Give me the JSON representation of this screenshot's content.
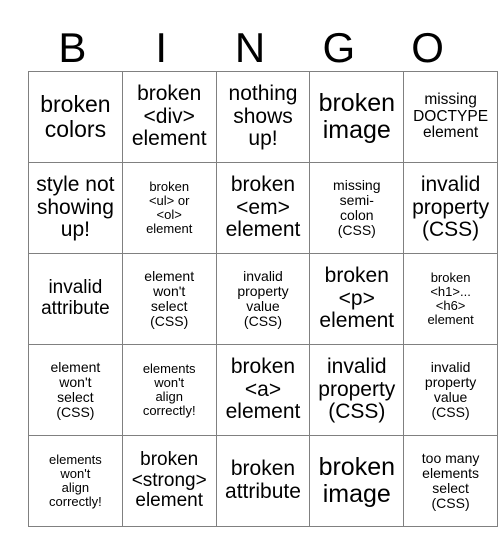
{
  "card": {
    "header": {
      "letters": [
        "B",
        "I",
        "N",
        "G",
        "O"
      ]
    },
    "rows": [
      [
        {
          "text": "broken\ncolors",
          "size": "fs-lg"
        },
        {
          "text": "broken\n<div>\nelement",
          "size": "fs-md"
        },
        {
          "text": "nothing\nshows\nup!",
          "size": "fs-md"
        },
        {
          "text": "broken\nimage",
          "size": "fs-xl"
        },
        {
          "text": "missing\nDOCTYPE\nelement",
          "size": "fs-xs"
        }
      ],
      [
        {
          "text": "style not\nshowing\nup!",
          "size": "fs-md"
        },
        {
          "text": "broken\n<ul> or\n<ol>\nelement",
          "size": "fs-tiny"
        },
        {
          "text": "broken\n<em>\nelement",
          "size": "fs-md"
        },
        {
          "text": "missing\nsemi-\ncolon\n(CSS)",
          "size": "fs-xxs"
        },
        {
          "text": "invalid\nproperty\n(CSS)",
          "size": "fs-md"
        }
      ],
      [
        {
          "text": "invalid\nattribute",
          "size": "fs-sm"
        },
        {
          "text": "element\nwon't\nselect\n(CSS)",
          "size": "fs-xxs"
        },
        {
          "text": "invalid\nproperty\nvalue\n(CSS)",
          "size": "fs-xxs"
        },
        {
          "text": "broken\n<p>\nelement",
          "size": "fs-md"
        },
        {
          "text": "broken\n<h1>...\n<h6>\nelement",
          "size": "fs-tiny"
        }
      ],
      [
        {
          "text": "element\nwon't\nselect\n(CSS)",
          "size": "fs-xxs"
        },
        {
          "text": "elements\nwon't\nalign\ncorrectly!",
          "size": "fs-tiny"
        },
        {
          "text": "broken\n<a>\nelement",
          "size": "fs-md"
        },
        {
          "text": "invalid\nproperty\n(CSS)",
          "size": "fs-md"
        },
        {
          "text": "invalid\nproperty\nvalue\n(CSS)",
          "size": "fs-xxs"
        }
      ],
      [
        {
          "text": "elements\nwon't\nalign\ncorrectly!",
          "size": "fs-tiny"
        },
        {
          "text": "broken\n<strong>\nelement",
          "size": "fs-sm"
        },
        {
          "text": "broken\nattribute",
          "size": "fs-md"
        },
        {
          "text": "broken\nimage",
          "size": "fs-xl"
        },
        {
          "text": "too many\nelements\nselect\n(CSS)",
          "size": "fs-xxs"
        }
      ]
    ]
  }
}
